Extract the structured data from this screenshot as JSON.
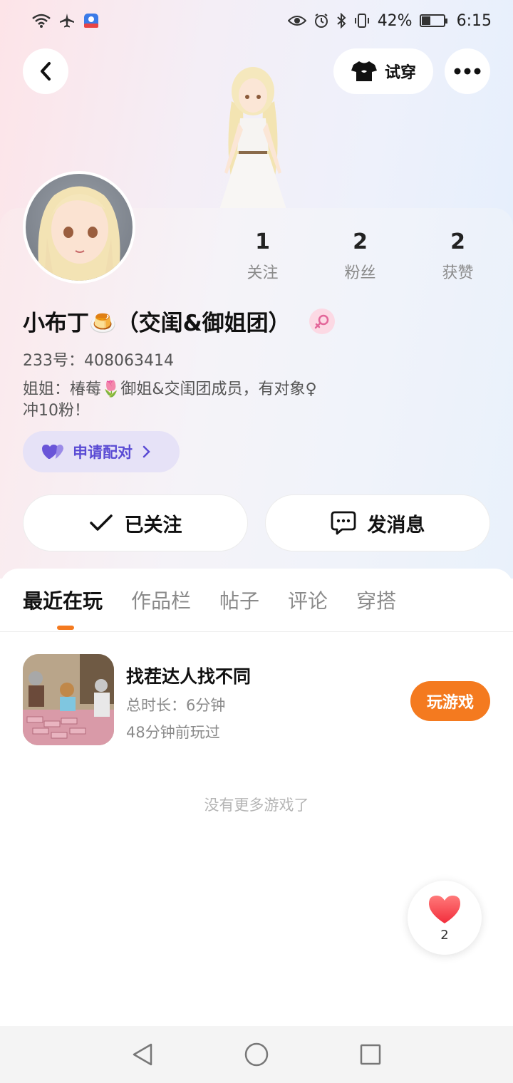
{
  "status_bar": {
    "battery_text": "42%",
    "battery_level": 0.42,
    "time": "6:15"
  },
  "header": {
    "tryon_label": "试穿"
  },
  "profile": {
    "name": "小布丁🍮（交闺&御姐团）",
    "uid": "233号：408063414",
    "bio_line1": "姐姐：椿莓🌷御姐&交闺团成员，有对象♀",
    "bio_line2": "冲10粉！",
    "pair_label": "申请配对"
  },
  "stats": [
    {
      "value": "1",
      "label": "关注"
    },
    {
      "value": "2",
      "label": "粉丝"
    },
    {
      "value": "2",
      "label": "获赞"
    }
  ],
  "actions": {
    "follow_label": "已关注",
    "message_label": "发消息"
  },
  "tabs": [
    {
      "label": "最近在玩",
      "active": true
    },
    {
      "label": "作品栏",
      "active": false
    },
    {
      "label": "帖子",
      "active": false
    },
    {
      "label": "评论",
      "active": false
    },
    {
      "label": "穿搭",
      "active": false
    }
  ],
  "games": [
    {
      "title": "找茬达人找不同",
      "duration": "总时长：6分钟",
      "last_played": "48分钟前玩过",
      "play_label": "玩游戏"
    }
  ],
  "no_more_text": "没有更多游戏了",
  "like_float": {
    "count": "2"
  },
  "colors": {
    "accent_orange": "#f47a1f",
    "pair_purple": "#5a4bd4",
    "pair_bg": "#e6e2f7"
  }
}
